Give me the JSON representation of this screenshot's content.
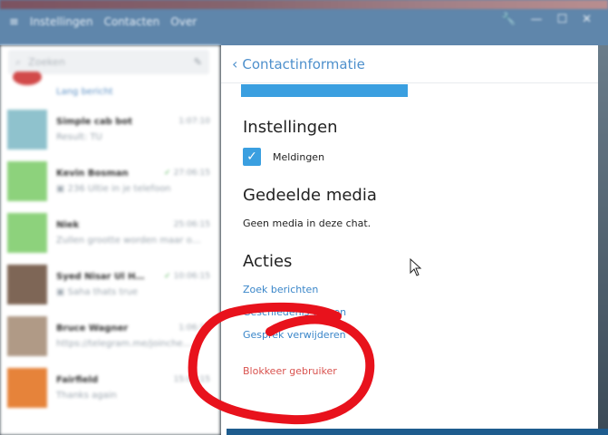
{
  "window": {
    "menu": [
      "≡",
      "Instellingen",
      "Contacten",
      "Over"
    ],
    "controls": [
      "🔧",
      "—",
      "☐",
      "✕"
    ]
  },
  "left_pane": {
    "search_placeholder": "Zoeken",
    "first_item_preview": "Lang bericht",
    "chats": [
      {
        "name": "Simple cab bot",
        "time": "1:07:10",
        "preview": "Result: TU",
        "check": false,
        "avatar": "#8fc2cd"
      },
      {
        "name": "Kevin Bosman",
        "time": "27:06:15",
        "preview": "▣ 236 Ultie in je telefoon",
        "check": true,
        "avatar": "#8dd27c"
      },
      {
        "name": "Niek",
        "time": "25:06:15",
        "preview": "Zullen grootte worden maar o…",
        "check": false,
        "avatar": "#8dd27c"
      },
      {
        "name": "Syed Nisar Ul H…",
        "time": "10:06:15",
        "preview": "▣ Saha thats true",
        "check": true,
        "avatar": "#7e6656"
      },
      {
        "name": "Bruce Wagner",
        "time": "1:06:15",
        "preview": "https://telegram.me/joinche…",
        "check": false,
        "avatar": "#b09a86"
      },
      {
        "name": "Fairfield",
        "time": "15:06:15",
        "preview": "Thanks again",
        "check": false,
        "avatar": "#e6833a"
      }
    ]
  },
  "right_pane": {
    "back_icon": "‹",
    "header_title": "Contactinformatie",
    "settings_title": "Instellingen",
    "notifications_label": "Meldingen",
    "notifications_checked": true,
    "shared_media_title": "Gedeelde media",
    "shared_media_text": "Geen media in deze chat.",
    "actions_title": "Acties",
    "actions": {
      "search": "Zoek berichten",
      "clear_history": "Geschiedenis wissen",
      "delete_chat": "Gesprek verwijderen",
      "block_user": "Blokkeer gebruiker"
    }
  },
  "annotation": {
    "color": "#e8121c"
  }
}
